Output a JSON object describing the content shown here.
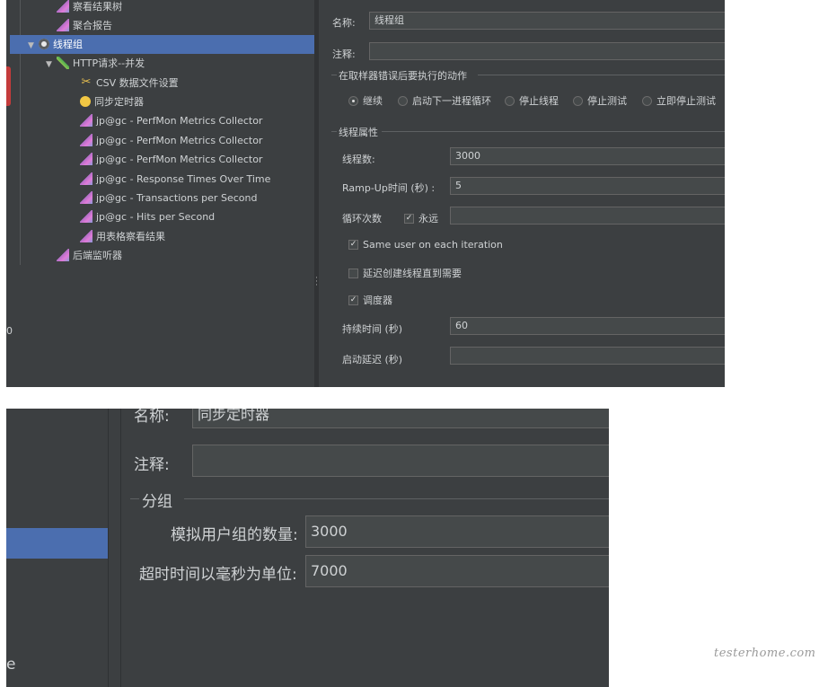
{
  "top": {
    "tree": [
      {
        "label": "察看结果树",
        "icon": "chart-icon",
        "indent": 1,
        "caret": ""
      },
      {
        "label": "聚合报告",
        "icon": "chart-icon",
        "indent": 1,
        "caret": ""
      },
      {
        "label": "线程组",
        "icon": "gear-icon",
        "indent": 0,
        "caret": "▼",
        "selected": true
      },
      {
        "label": "HTTP请求--并发",
        "icon": "pen-icon",
        "indent": 1,
        "caret": "▼"
      },
      {
        "label": "CSV 数据文件设置",
        "icon": "csv-icon",
        "indent": 2,
        "caret": ""
      },
      {
        "label": "同步定时器",
        "icon": "timer-icon",
        "indent": 2,
        "caret": ""
      },
      {
        "label": "jp@gc - PerfMon Metrics Collector",
        "icon": "chart-icon",
        "indent": 2,
        "caret": ""
      },
      {
        "label": "jp@gc - PerfMon Metrics Collector",
        "icon": "chart-icon",
        "indent": 2,
        "caret": ""
      },
      {
        "label": "jp@gc - PerfMon Metrics Collector",
        "icon": "chart-icon",
        "indent": 2,
        "caret": ""
      },
      {
        "label": "jp@gc - Response Times Over Time",
        "icon": "chart-icon",
        "indent": 2,
        "caret": ""
      },
      {
        "label": "jp@gc - Transactions per Second",
        "icon": "chart-icon",
        "indent": 2,
        "caret": ""
      },
      {
        "label": "jp@gc - Hits per Second",
        "icon": "chart-icon",
        "indent": 2,
        "caret": ""
      },
      {
        "label": "用表格察看结果",
        "icon": "chart-icon",
        "indent": 2,
        "caret": ""
      },
      {
        "label": "后端监听器",
        "icon": "chart-icon",
        "indent": 1,
        "caret": ""
      }
    ],
    "form": {
      "name_label": "名称:",
      "name_value": "线程组",
      "comment_label": "注释:",
      "comment_value": "",
      "error_group_title": "在取样器错误后要执行的动作",
      "error_actions": [
        {
          "label": "继续",
          "selected": true
        },
        {
          "label": "启动下一进程循环",
          "selected": false
        },
        {
          "label": "停止线程",
          "selected": false
        },
        {
          "label": "停止测试",
          "selected": false
        },
        {
          "label": "立即停止测试",
          "selected": false
        }
      ],
      "thread_props_title": "线程属性",
      "threads_label": "线程数:",
      "threads_value": "3000",
      "rampup_label": "Ramp-Up时间 (秒) :",
      "rampup_value": "5",
      "loop_label": "循环次数",
      "forever_label": "永远",
      "forever_checked": true,
      "loop_value": "",
      "same_user_label": "Same user on each iteration",
      "same_user_checked": true,
      "delay_create_label": "延迟创建线程直到需要",
      "delay_create_checked": false,
      "scheduler_label": "调度器",
      "scheduler_checked": true,
      "duration_label": "持续时间 (秒)",
      "duration_value": "60",
      "startup_delay_label": "启动延迟 (秒)",
      "startup_delay_value": ""
    },
    "left_edge_char": "0"
  },
  "bottom": {
    "name_label": "名称:",
    "name_value": "同步定时器",
    "comment_label": "注释:",
    "comment_value": "",
    "group_title": "分组",
    "num_users_label": "模拟用户组的数量:",
    "num_users_value": "3000",
    "timeout_label": "超时时间以毫秒为单位:",
    "timeout_value": "7000",
    "edge_char": "e"
  },
  "watermark": "testerhome.com"
}
